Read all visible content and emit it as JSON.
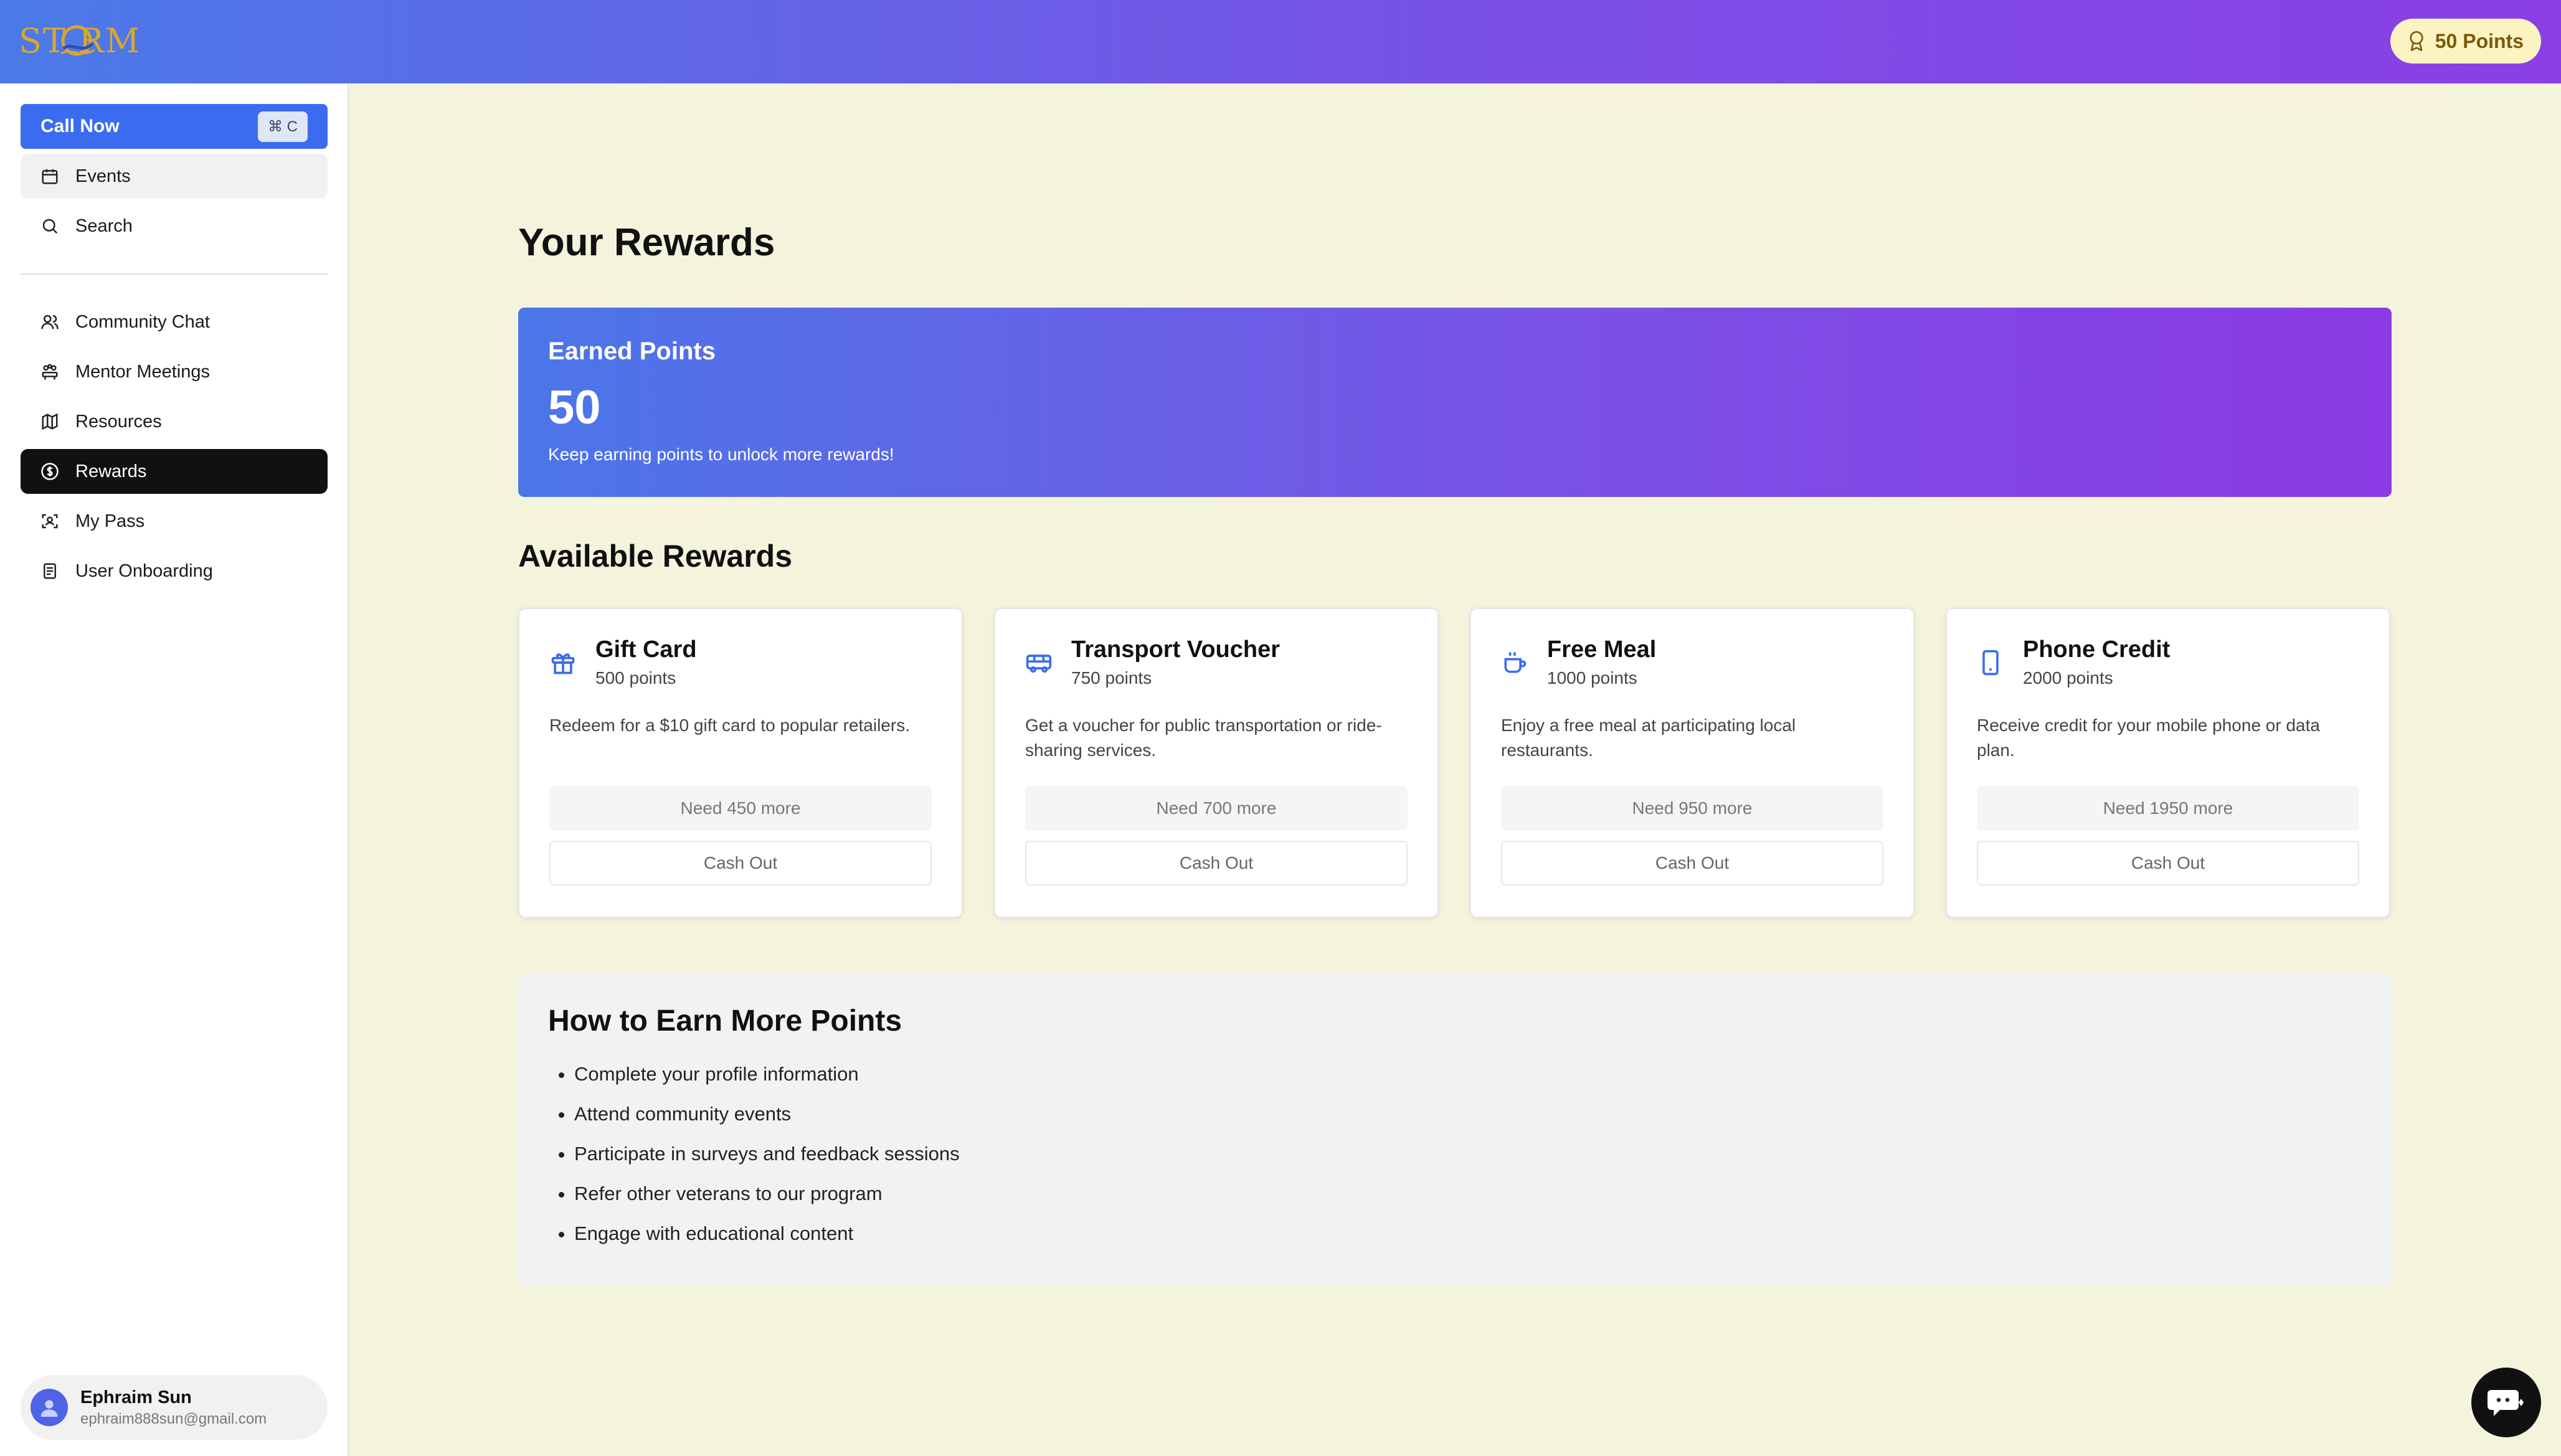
{
  "header": {
    "logo_text": "ST RM",
    "points_label": "50 Points"
  },
  "sidebar": {
    "call_now": {
      "label": "Call Now",
      "shortcut": "⌘ C"
    },
    "top_items": [
      {
        "label": "Events",
        "icon": "calendar-icon"
      },
      {
        "label": "Search",
        "icon": "search-icon"
      }
    ],
    "items": [
      {
        "label": "Community Chat",
        "icon": "users-icon"
      },
      {
        "label": "Mentor Meetings",
        "icon": "meeting-icon"
      },
      {
        "label": "Resources",
        "icon": "map-icon"
      },
      {
        "label": "Rewards",
        "icon": "dollar-circle-icon",
        "active": true
      },
      {
        "label": "My Pass",
        "icon": "scan-face-icon"
      },
      {
        "label": "User Onboarding",
        "icon": "clipboard-icon"
      }
    ],
    "user": {
      "name": "Ephraim Sun",
      "email": "ephraim888sun@gmail.com"
    }
  },
  "main": {
    "title": "Your Rewards",
    "earned": {
      "label": "Earned Points",
      "value": "50",
      "note": "Keep earning points to unlock more rewards!"
    },
    "available_title": "Available Rewards",
    "rewards": [
      {
        "title": "Gift Card",
        "points": "500 points",
        "desc": "Redeem for a $10 gift card to popular retailers.",
        "need": "Need 450 more",
        "cash": "Cash Out",
        "icon": "gift-icon"
      },
      {
        "title": "Transport Voucher",
        "points": "750 points",
        "desc": "Get a voucher for public transportation or ride-sharing services.",
        "need": "Need 700 more",
        "cash": "Cash Out",
        "icon": "bus-icon"
      },
      {
        "title": "Free Meal",
        "points": "1000 points",
        "desc": "Enjoy a free meal at participating local restaurants.",
        "need": "Need 950 more",
        "cash": "Cash Out",
        "icon": "coffee-icon"
      },
      {
        "title": "Phone Credit",
        "points": "2000 points",
        "desc": "Receive credit for your mobile phone or data plan.",
        "need": "Need 1950 more",
        "cash": "Cash Out",
        "icon": "phone-icon"
      }
    ],
    "earn_more": {
      "title": "How to Earn More Points",
      "items": [
        "Complete your profile information",
        "Attend community events",
        "Participate in surveys and feedback sessions",
        "Refer other veterans to our program",
        "Engage with educational content"
      ]
    }
  },
  "colors": {
    "accent_blue": "#3b6cf0",
    "gradient_start": "#4a7ae8",
    "gradient_end": "#8a3fe4",
    "page_bg": "#f4f3dc",
    "logo_gold": "#d9a62e"
  }
}
